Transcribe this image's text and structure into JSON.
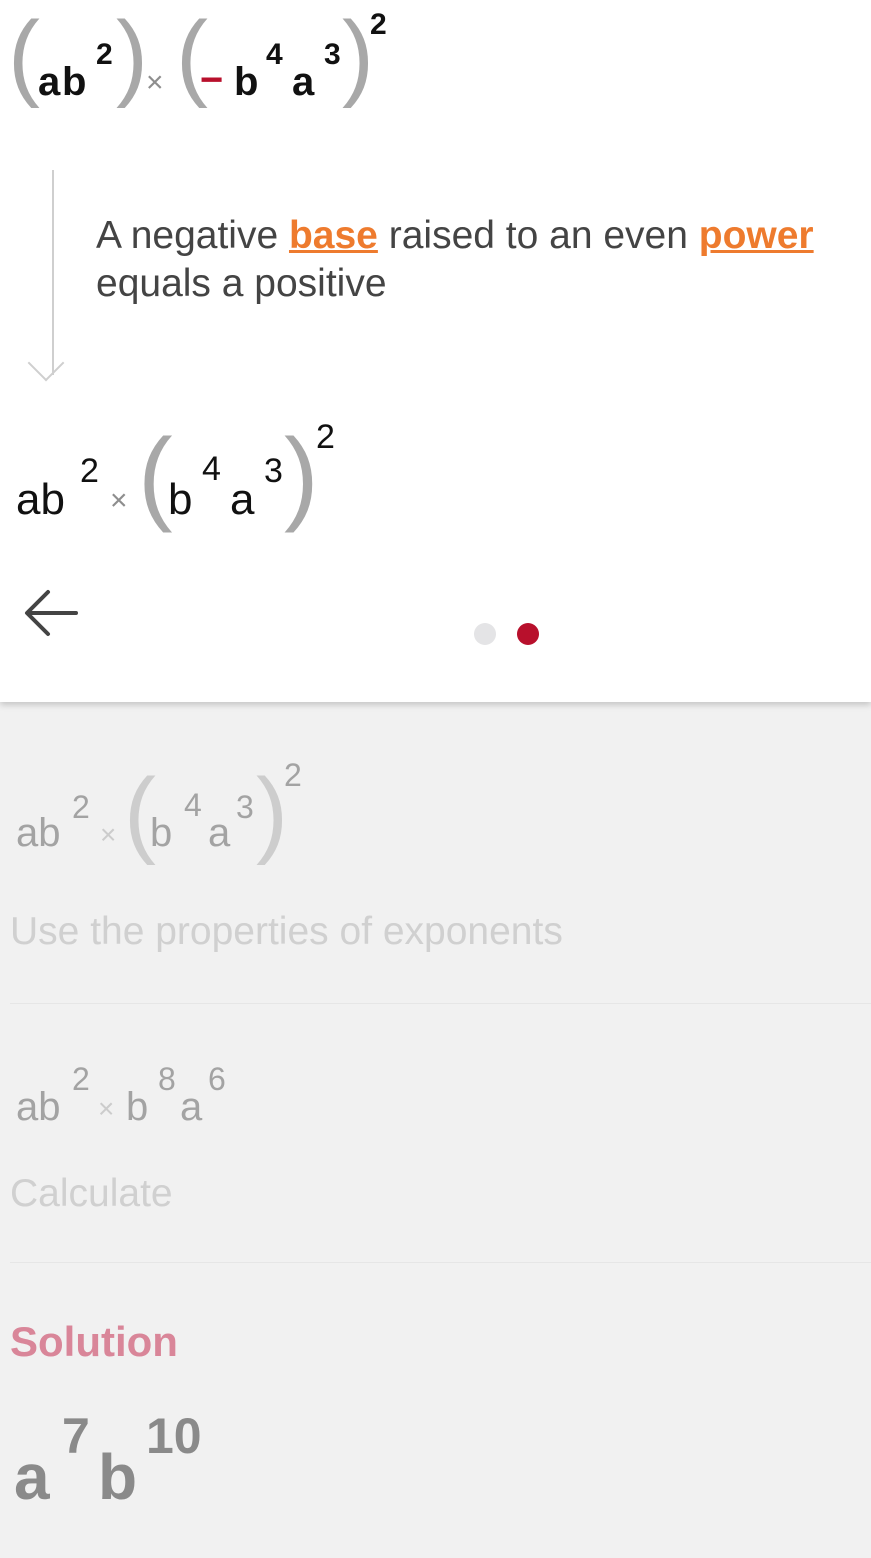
{
  "step_card": {
    "original_expression": {
      "a": "a",
      "b": "b",
      "exp_b": "2",
      "times": "×",
      "minus": "−",
      "b2": "b",
      "exp_b2": "4",
      "a2": "a",
      "exp_a2": "3",
      "outer_exp": "2",
      "open_paren": "(",
      "close_paren": ")"
    },
    "explanation": {
      "part1": "A negative ",
      "keyword1": "base",
      "part2": " raised to an even ",
      "keyword2": "power",
      "part3": " equals a positive"
    },
    "result_expression": {
      "ab": "ab",
      "exp_b": "2",
      "times": "×",
      "b": "b",
      "exp_b2": "4",
      "a": "a",
      "exp_a": "3",
      "outer_exp": "2",
      "open_paren": "(",
      "close_paren": ")"
    },
    "back_icon": "arrow-left-icon",
    "pager": {
      "total": 2,
      "active_index": 1,
      "active_color": "#b8102c",
      "inactive_color": "#e4e4e6"
    }
  },
  "steps": [
    {
      "expression": {
        "ab": "ab",
        "exp_b": "2",
        "times": "×",
        "b": "b",
        "exp_b2": "4",
        "a": "a",
        "exp_a": "3",
        "outer_exp": "2",
        "open_paren": "(",
        "close_paren": ")"
      },
      "description": "Use the properties of exponents"
    },
    {
      "expression": {
        "ab": "ab",
        "exp_b": "2",
        "times": "×",
        "b": "b",
        "exp_b2": "8",
        "a": "a",
        "exp_a": "6"
      },
      "description": "Calculate"
    }
  ],
  "solution": {
    "label": "Solution",
    "a": "a",
    "exp_a": "7",
    "b": "b",
    "exp_b": "10"
  },
  "colors": {
    "accent": "#ee7b2e",
    "brand": "#b8102c",
    "solution_label": "#d98699"
  }
}
